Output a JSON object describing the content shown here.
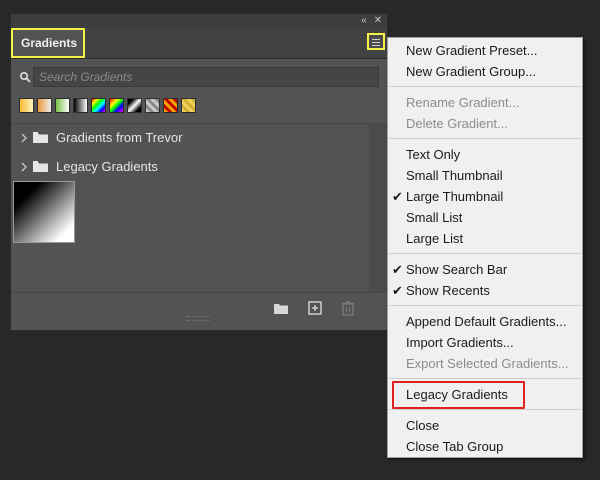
{
  "panel": {
    "tab_label": "Gradients",
    "topbar_icons": [
      "collapse-double-chevron-icon",
      "close-icon"
    ],
    "search": {
      "placeholder": "Search Gradients",
      "value": ""
    },
    "recent_swatches": [
      {
        "name": "orange-yellow-gradient"
      },
      {
        "name": "transparent-orange-gradient"
      },
      {
        "name": "green-gradient"
      },
      {
        "name": "black-white-gradient"
      },
      {
        "name": "spectrum-gradient"
      },
      {
        "name": "rainbow-diagonal-gradient"
      },
      {
        "name": "black-white-diagonal-gradient"
      },
      {
        "name": "transparent-gray-gradient"
      },
      {
        "name": "orange-red-stripes-gradient"
      },
      {
        "name": "transparent-yellow-gradient"
      }
    ],
    "groups": [
      {
        "label": "Gradients from Trevor"
      },
      {
        "label": "Legacy Gradients"
      }
    ],
    "bottom_icons": [
      "new-group-folder-icon",
      "new-gradient-icon",
      "delete-trash-icon"
    ]
  },
  "menu": {
    "items": [
      {
        "label": "New Gradient Preset...",
        "enabled": true,
        "checked": false
      },
      {
        "label": "New Gradient Group...",
        "enabled": true,
        "checked": false
      },
      {
        "label": "Rename Gradient...",
        "enabled": false,
        "checked": false
      },
      {
        "label": "Delete Gradient...",
        "enabled": false,
        "checked": false
      },
      {
        "label": "Text Only",
        "enabled": true,
        "checked": false
      },
      {
        "label": "Small Thumbnail",
        "enabled": true,
        "checked": false
      },
      {
        "label": "Large Thumbnail",
        "enabled": true,
        "checked": true
      },
      {
        "label": "Small List",
        "enabled": true,
        "checked": false
      },
      {
        "label": "Large List",
        "enabled": true,
        "checked": false
      },
      {
        "label": "Show Search Bar",
        "enabled": true,
        "checked": true
      },
      {
        "label": "Show Recents",
        "enabled": true,
        "checked": true
      },
      {
        "label": "Append Default Gradients...",
        "enabled": true,
        "checked": false
      },
      {
        "label": "Import Gradients...",
        "enabled": true,
        "checked": false
      },
      {
        "label": "Export Selected Gradients...",
        "enabled": false,
        "checked": false
      },
      {
        "label": "Legacy Gradients",
        "enabled": true,
        "checked": false,
        "highlighted": true
      },
      {
        "label": "Close",
        "enabled": true,
        "checked": false
      },
      {
        "label": "Close Tab Group",
        "enabled": true,
        "checked": false
      }
    ],
    "check_glyph": "✔"
  },
  "colors": {
    "highlight_yellow": "#f2f247",
    "highlight_red": "#e02020",
    "panel_bg": "#535353",
    "menu_bg": "#f0f0f0"
  }
}
